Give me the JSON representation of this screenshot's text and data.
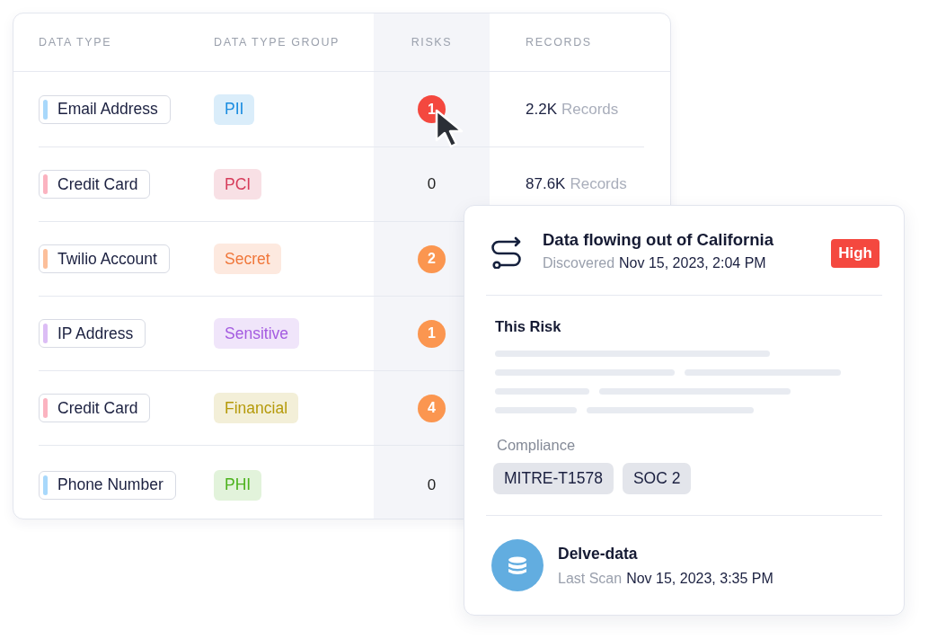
{
  "table": {
    "columns": [
      "DATA TYPE",
      "DATA TYPE GROUP",
      "RISKS",
      "RECORDS"
    ],
    "rows": [
      {
        "data_type": {
          "label": "Email Address",
          "color": "#a8d8fb"
        },
        "group": {
          "label": "PII",
          "color": "#1a8ce0"
        },
        "risks": {
          "value": "1",
          "kind": "badge",
          "color": "#f4483f"
        },
        "records": {
          "count": "2.2K",
          "unit": "Records"
        }
      },
      {
        "data_type": {
          "label": "Credit Card",
          "color": "#fbb3c0"
        },
        "group": {
          "label": "PCI",
          "color": "#d63b5a"
        },
        "risks": {
          "value": "0",
          "kind": "plain"
        },
        "records": {
          "count": "87.6K",
          "unit": "Records"
        }
      },
      {
        "data_type": {
          "label": "Twilio Account",
          "color": "#fcbf9a"
        },
        "group": {
          "label": "Secret",
          "color": "#f0773a"
        },
        "risks": {
          "value": "2",
          "kind": "badge",
          "color": "#fb9650"
        }
      },
      {
        "data_type": {
          "label": "IP Address",
          "color": "#dcbdf5"
        },
        "group": {
          "label": "Sensitive",
          "color": "#a45be0"
        },
        "risks": {
          "value": "1",
          "kind": "badge",
          "color": "#fb9650"
        }
      },
      {
        "data_type": {
          "label": "Credit Card",
          "color": "#fbb3c0"
        },
        "group": {
          "label": "Financial",
          "color": "#b59a0a"
        },
        "risks": {
          "value": "4",
          "kind": "badge",
          "color": "#fb9650"
        }
      },
      {
        "data_type": {
          "label": "Phone Number",
          "color": "#a8d8fb"
        },
        "group": {
          "label": "PHI",
          "color": "#4cb21c"
        },
        "risks": {
          "value": "0",
          "kind": "plain"
        }
      }
    ]
  },
  "risk_card": {
    "title": "Data flowing out of California",
    "discovered_label": "Discovered",
    "discovered_date": "Nov 15, 2023, 2:04 PM",
    "severity": "High",
    "section_title": "This Risk",
    "compliance_label": "Compliance",
    "compliance_tags": [
      "MITRE-T1578",
      "SOC 2"
    ],
    "source": {
      "name": "Delve-data",
      "scan_label": "Last Scan",
      "scan_date": "Nov 15, 2023, 3:35 PM"
    }
  }
}
